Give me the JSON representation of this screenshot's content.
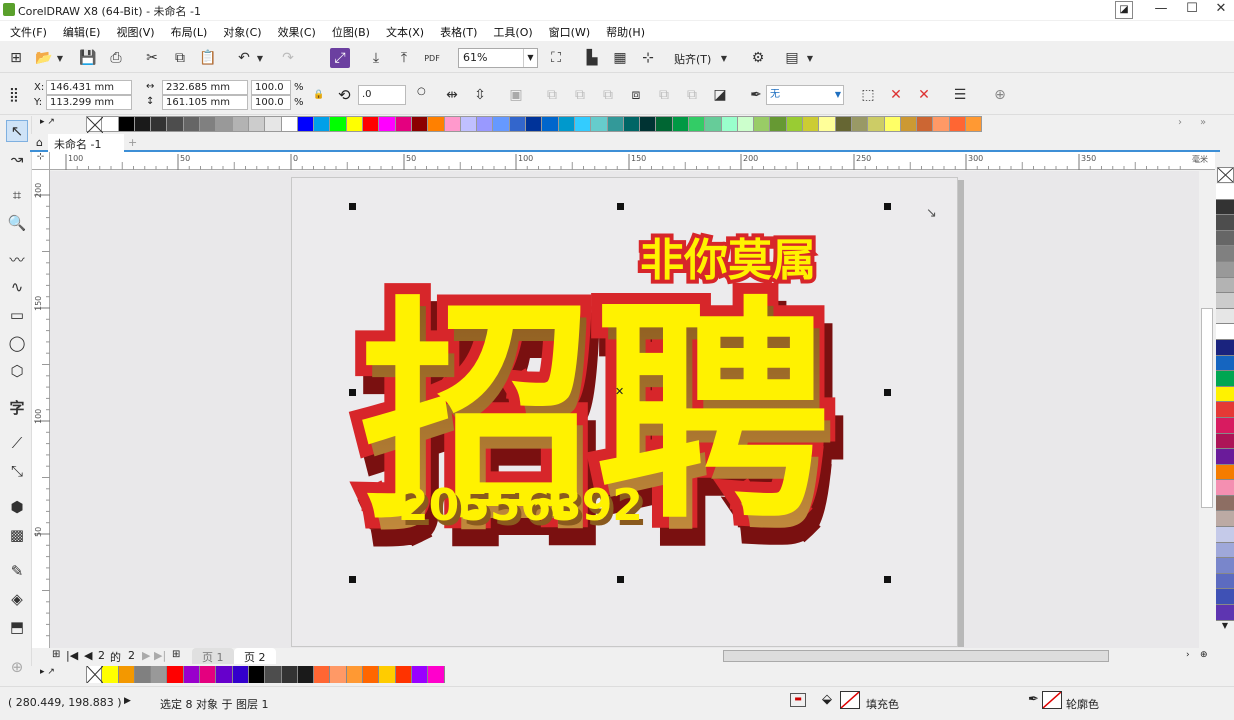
{
  "window": {
    "title": "CorelDRAW X8 (64-Bit) - 未命名 -1",
    "min_icon": "minimize-icon",
    "max_icon": "maximize-icon",
    "close_icon": "close-icon"
  },
  "menu": [
    "文件(F)",
    "编辑(E)",
    "视图(V)",
    "布局(L)",
    "对象(C)",
    "效果(C)",
    "位图(B)",
    "文本(X)",
    "表格(T)",
    "工具(O)",
    "窗口(W)",
    "帮助(H)"
  ],
  "toolbar": {
    "zoom": "61%",
    "snap_label": "贴齐(T)",
    "pdf_label": "PDF"
  },
  "props": {
    "x_label": "X:",
    "x_value": "146.431 mm",
    "y_label": "Y:",
    "y_value": "113.299 mm",
    "w_value": "232.685 mm",
    "h_value": "161.105 mm",
    "sx_value": "100.0",
    "sy_value": "100.0",
    "pct": "%",
    "angle_value": ".0",
    "outline_value": "无"
  },
  "tabs": {
    "doc_tab": "未命名 -1"
  },
  "ruler": {
    "h_ticks": [
      "100",
      "50",
      "0",
      "50",
      "100",
      "150",
      "200",
      "250",
      "300",
      "350"
    ],
    "unit": "毫米",
    "v_ticks": [
      "200",
      "150",
      "100",
      "50"
    ]
  },
  "artwork": {
    "main_text": "招聘",
    "sub_text": "非你莫属",
    "number_text": "20556392"
  },
  "pagenav": {
    "current": "2",
    "of": "的",
    "total": "2",
    "page1": "页 1",
    "page2": "页 2"
  },
  "status": {
    "coords": "( 280.449, 198.883 )",
    "selection": "选定 8 对象 于 图层 1",
    "fill_label": "填充色",
    "outline_label": "轮廓色"
  },
  "colors": {
    "accent_blue": "#3d8fd6",
    "art_yellow": "#fff200",
    "art_red": "#d7262a",
    "art_shadow": "#7a1010"
  },
  "palette_top": [
    "#ffffff",
    "#000000",
    "#1a1a1a",
    "#333333",
    "#4d4d4d",
    "#666666",
    "#808080",
    "#999999",
    "#b3b3b3",
    "#cccccc",
    "#e6e6e6",
    "#ffffff",
    "#0000ff",
    "#00a0e9",
    "#00ff00",
    "#ffff00",
    "#ff0000",
    "#ff00ff",
    "#e4007f",
    "#8b0000",
    "#ff8000",
    "#ff99cc",
    "#c0c0ff",
    "#9999ff",
    "#6699ff",
    "#3366cc",
    "#003399",
    "#0066cc",
    "#0099cc",
    "#33ccff",
    "#66cccc",
    "#339999",
    "#006666",
    "#003333",
    "#006633",
    "#009944",
    "#33cc66",
    "#66cc99",
    "#99ffcc",
    "#ccffcc",
    "#99cc66",
    "#669933",
    "#99cc33",
    "#cccc33",
    "#ffff99",
    "#666633",
    "#999966",
    "#cccc66",
    "#ffff66",
    "#cc9933",
    "#cc6633",
    "#ff9966",
    "#ff6633",
    "#ff9933"
  ],
  "palette_right": [
    "#ffffff",
    "#333333",
    "#4d4d4d",
    "#666666",
    "#808080",
    "#999999",
    "#b3b3b3",
    "#cccccc",
    "#e6e6e6",
    "#ffffff",
    "#1a237e",
    "#1565c0",
    "#00a651",
    "#fff200",
    "#e53935",
    "#d81b60",
    "#ad1457",
    "#6a1b9a",
    "#f57c00",
    "#f48fb1",
    "#8d6e63",
    "#bcaaa4",
    "#c5cae9",
    "#9fa8da",
    "#7986cb",
    "#5c6bc0",
    "#3f51b5",
    "#5e35b1"
  ],
  "palette_doc": [
    "#ffff00",
    "#f39800",
    "#808080",
    "#999999",
    "#ff0000",
    "#9900cc",
    "#e4007f",
    "#6600cc",
    "#3300cc",
    "#000000",
    "#4d4d4d",
    "#333333",
    "#1a1a1a",
    "#ff6633",
    "#ff9966",
    "#ff9933",
    "#ff6600",
    "#ffcc00",
    "#ff3300",
    "#9900ff",
    "#ff00cc"
  ]
}
